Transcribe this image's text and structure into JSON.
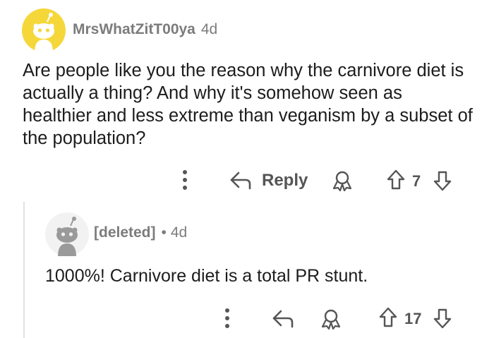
{
  "comment": {
    "author": "MrsWhatZitT00ya",
    "age": "4d",
    "body": "Are people like you the reason why the carnivore diet is actually a thing? And why it's somehow seen as healthier and less extreme than veganism by a subset of the population?",
    "actions": {
      "reply_label": "Reply",
      "vote_count": "7"
    },
    "avatar_color": "#f5d73a"
  },
  "reply": {
    "author": "[deleted]",
    "separator": "•",
    "age": "4d",
    "body": "1000%! Carnivore diet is a total PR stunt.",
    "actions": {
      "vote_count": "17"
    },
    "avatar_color": "#f2f2f2"
  },
  "icons": [
    "avatar-icon",
    "more-options-icon",
    "reply-icon",
    "award-icon",
    "upvote-icon",
    "downvote-icon"
  ],
  "colors": {
    "meta_text": "#7c7c7c",
    "action_text": "#555555",
    "thread_line": "#e1e1e1"
  }
}
